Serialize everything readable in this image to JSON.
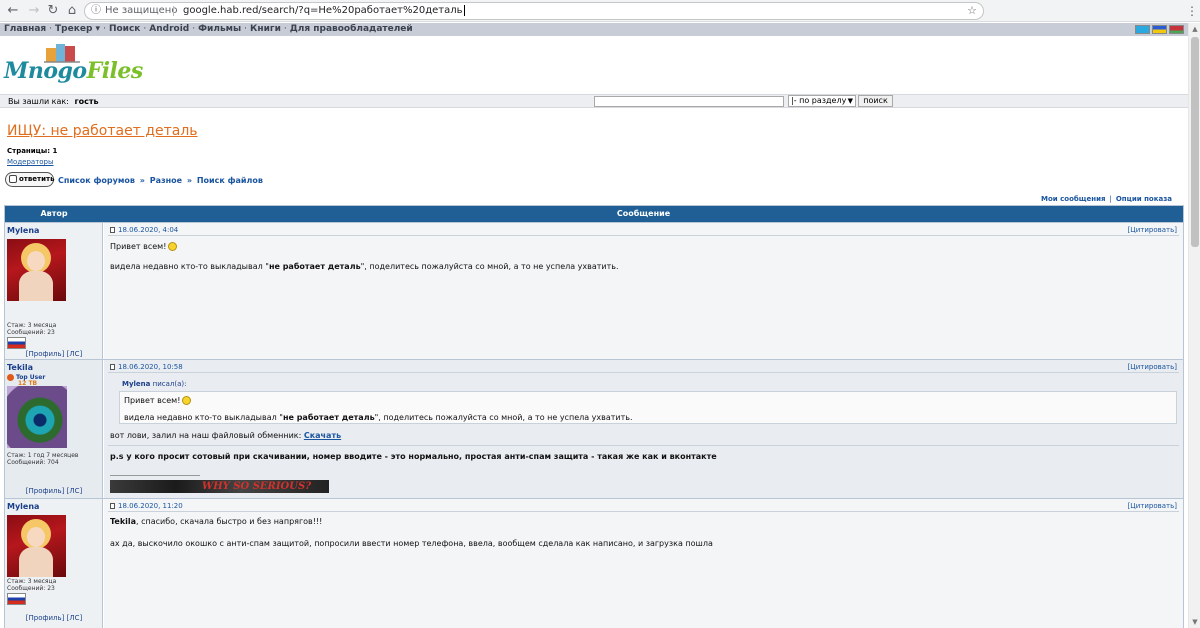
{
  "browser": {
    "back_icon": "back-arrow-icon",
    "forward_icon": "forward-arrow-icon",
    "reload_icon": "reload-icon",
    "home_icon": "home-icon",
    "security_label": "Не защищено",
    "url": "google.hab.red/search/?q=Не%20работает%20деталь",
    "star_icon": "star-icon",
    "menu_icon": "more-vert-icon"
  },
  "topnav": {
    "items": [
      "Главная",
      "Трекер",
      "Поиск",
      "Android",
      "Фильмы",
      "Книги",
      "Для правообладателей"
    ],
    "tracker_caret": "▾",
    "flags": [
      {
        "name": "flag-kazakhstan-icon",
        "color": "#2aa8e0"
      },
      {
        "name": "flag-ukraine-icon",
        "color": "#f2c80f"
      },
      {
        "name": "flag-belarus-icon",
        "color": "#c8313e"
      }
    ]
  },
  "logo": {
    "part1": "Mnogo",
    "part2": "Files"
  },
  "login_bar": {
    "label": "Вы зашли как:",
    "user": "гость",
    "search_placeholder": "",
    "section_select": "|- по разделу",
    "search_button": "поиск"
  },
  "topic": {
    "title": "ИЩУ: не работает деталь",
    "pages_label": "Страницы:",
    "pages_value": "1",
    "moderators": "Модераторы",
    "reply_button": "ответить",
    "breadcrumb": [
      "Список форумов",
      "Разное",
      "Поиск файлов"
    ],
    "breadcrumb_sep": "»",
    "my_messages": "Мои сообщения",
    "display_options": "Опции показа",
    "links_sep": "|"
  },
  "table_head": {
    "author": "Автор",
    "message": "Сообщение"
  },
  "posts": [
    {
      "author": "Mylena",
      "date": "18.06.2020, 4:04",
      "quote_link": "[Цитировать]",
      "stage": "Стаж: 3 месяца",
      "messages_count": "Сообщений: 23",
      "profile": "[Профиль]",
      "pm": "[ЛС]",
      "greeting": "Привет всем!",
      "line2_pre": "видела недавно кто-то выкладывал \"",
      "line2_bold": "не работает деталь",
      "line2_post": "\", поделитесь пожалуйста со мной, а то не успела ухватить."
    },
    {
      "author": "Tekila",
      "rank_title": "Top User",
      "rank_value": "12 TB",
      "date": "18.06.2020, 10:58",
      "quote_link": "[Цитировать]",
      "stage": "Стаж: 1 год 7 месяцев",
      "messages_count": "Сообщений: 704",
      "profile": "[Профиль]",
      "pm": "[ЛС]",
      "quote_author": "Mylena",
      "quote_wrote": "писал(а):",
      "quote_greeting": "Привет всем!",
      "quote_line_pre": "видела недавно кто-то выкладывал \"",
      "quote_line_bold": "не работает деталь",
      "quote_line_post": "\", поделитесь пожалуйста со мной, а то не успела ухватить.",
      "reply_text": "вот лови, залил на наш файловый обменник:",
      "download_link": "Скачать",
      "ps_text": "p.s у кого просит сотовый при скачивании, номер вводите - это нормально, простая анти-спам защита - такая же как и вконтакте",
      "signature_text": "WHY SO SERIOUS?"
    },
    {
      "author": "Mylena",
      "date": "18.06.2020, 11:20",
      "quote_link": "[Цитировать]",
      "stage": "Стаж: 3 месяца",
      "messages_count": "Сообщений: 23",
      "profile": "[Профиль]",
      "pm": "[ЛС]",
      "line1_bold": "Tekila",
      "line1_rest": ", спасибо, скачала быстро и без напрягов!!!",
      "line2": "ах да, выскочило окошко с анти-спам защитой, попросили ввести номер телефона, ввела, вообщем сделала как написано, и загрузка пошла"
    }
  ]
}
